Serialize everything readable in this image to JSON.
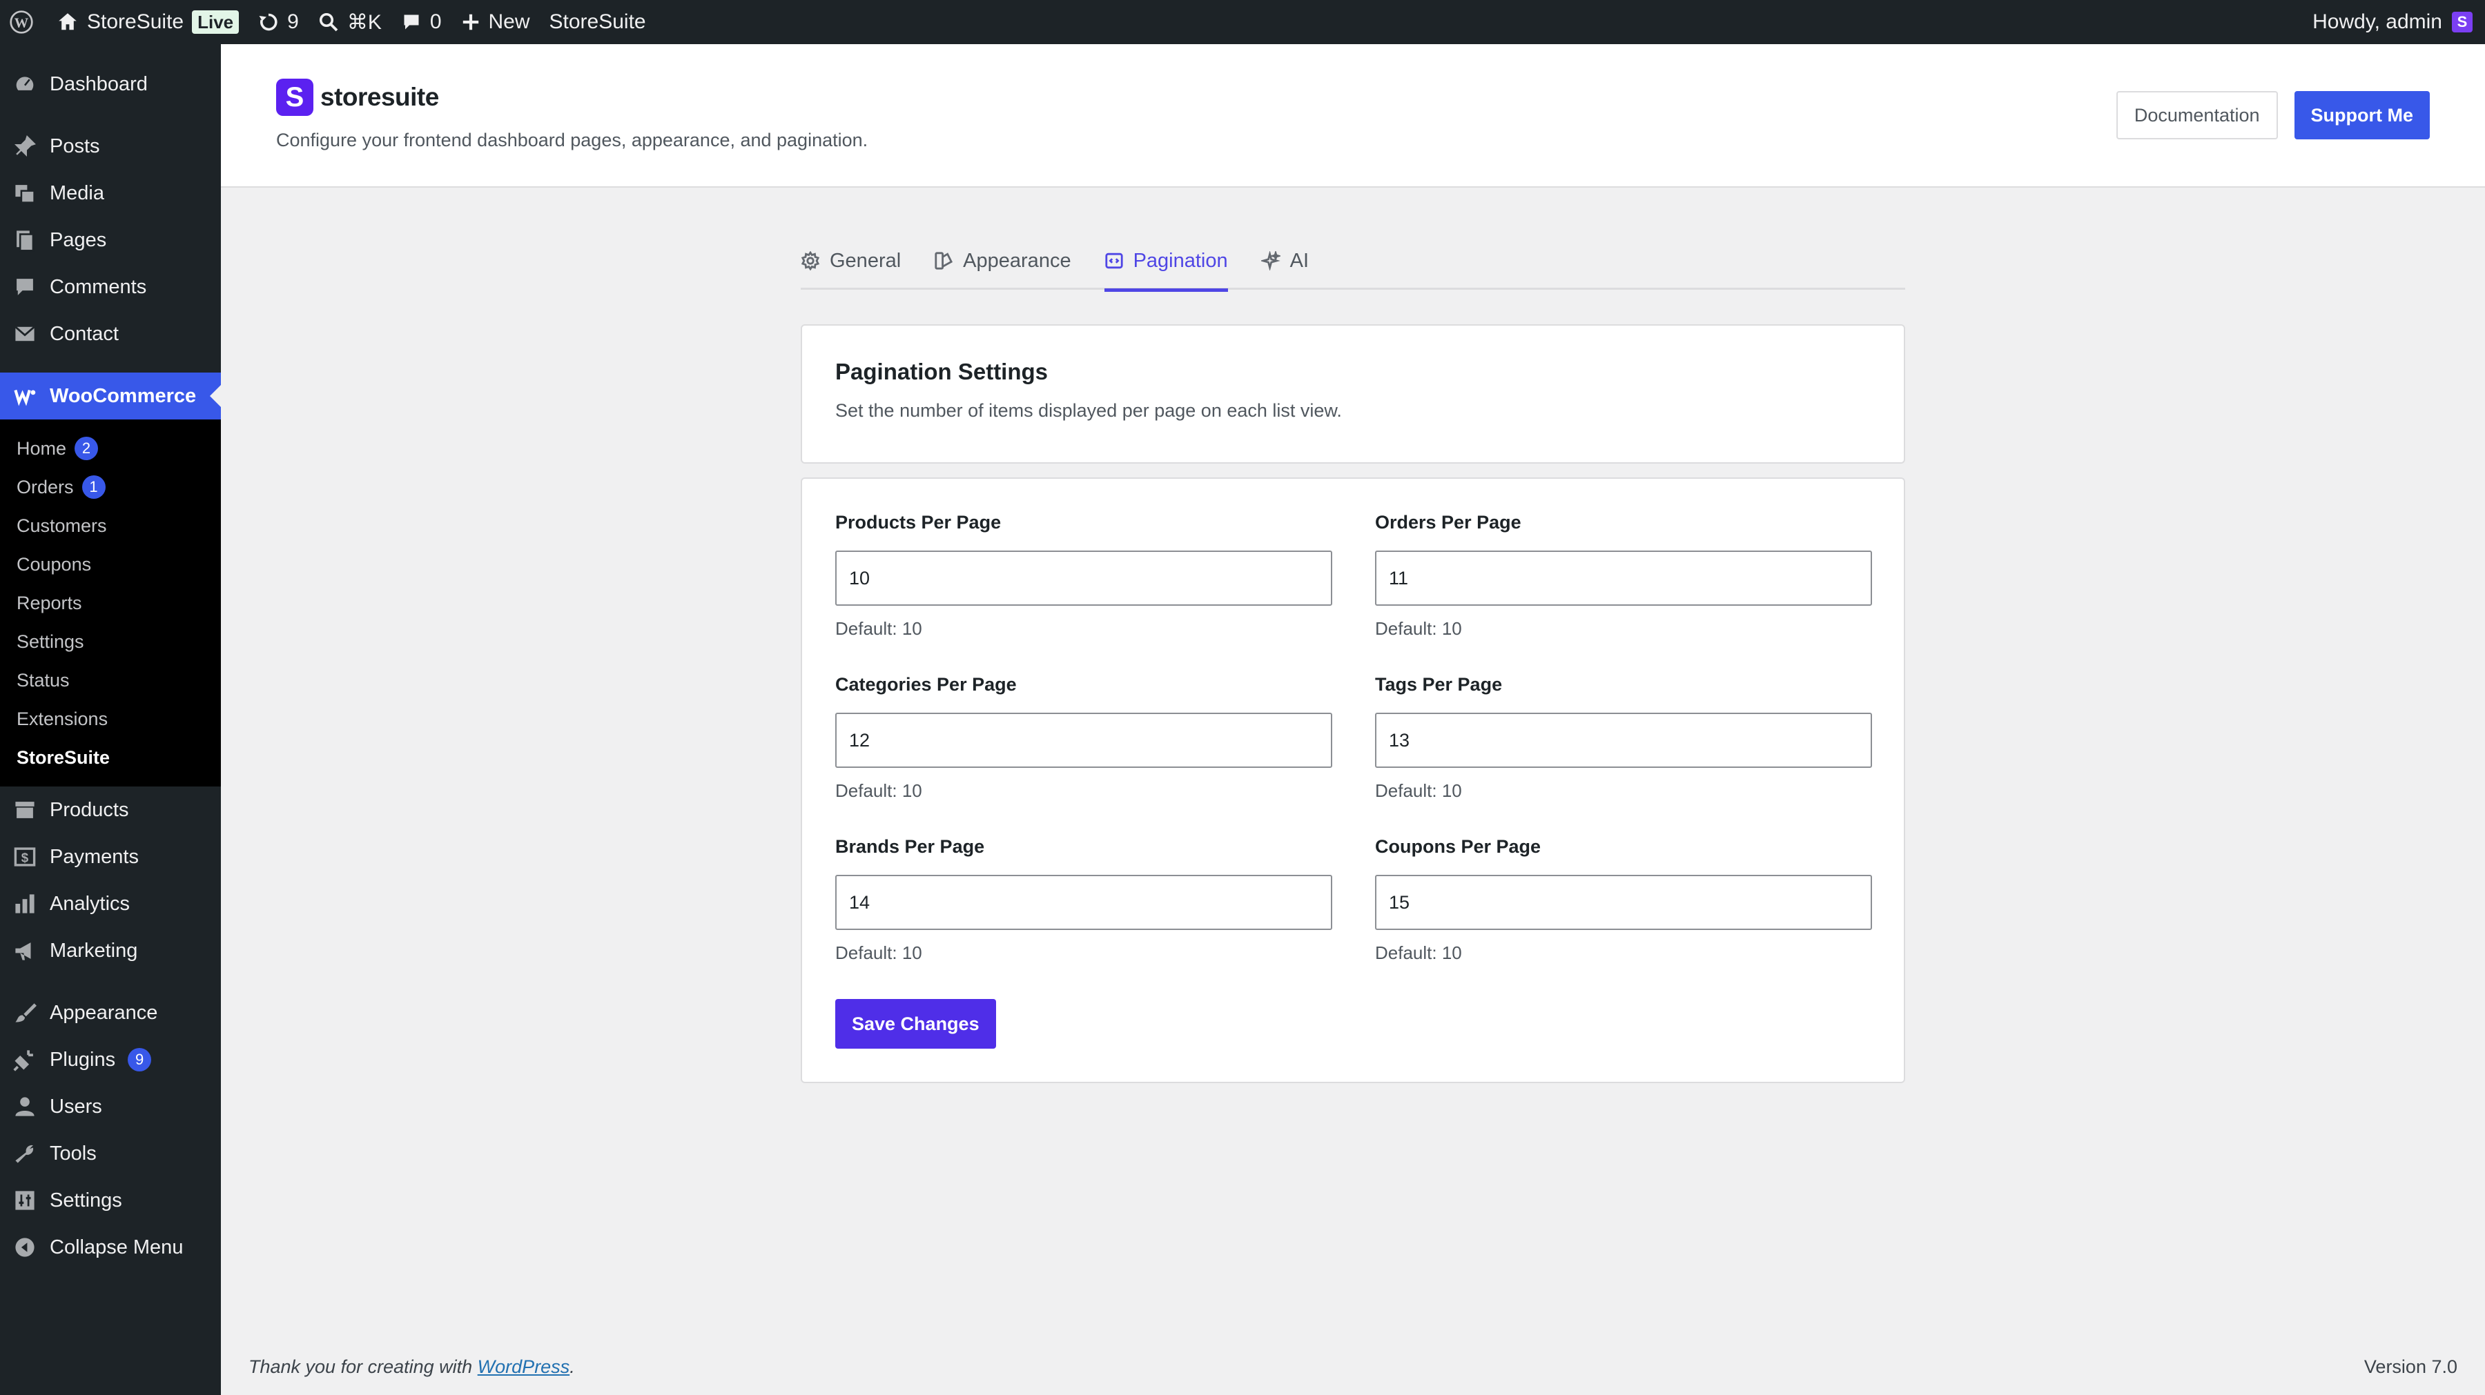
{
  "adminbar": {
    "site_name": "StoreSuite",
    "live_label": "Live",
    "updates_count": "9",
    "search_shortcut": "⌘K",
    "comments_count": "0",
    "new_label": "New",
    "plugin_label": "StoreSuite",
    "greeting": "Howdy, admin"
  },
  "sidebar": {
    "dashboard": "Dashboard",
    "posts": "Posts",
    "media": "Media",
    "pages": "Pages",
    "comments": "Comments",
    "contact": "Contact",
    "woocommerce": "WooCommerce",
    "woo_sub": [
      {
        "label": "Home",
        "badge": "2"
      },
      {
        "label": "Orders",
        "badge": "1"
      },
      {
        "label": "Customers"
      },
      {
        "label": "Coupons"
      },
      {
        "label": "Reports"
      },
      {
        "label": "Settings"
      },
      {
        "label": "Status"
      },
      {
        "label": "Extensions"
      },
      {
        "label": "StoreSuite"
      }
    ],
    "products": "Products",
    "payments": "Payments",
    "analytics": "Analytics",
    "marketing": "Marketing",
    "appearance": "Appearance",
    "plugins": "Plugins",
    "plugins_badge": "9",
    "users": "Users",
    "tools": "Tools",
    "settings": "Settings",
    "collapse": "Collapse Menu"
  },
  "header": {
    "brand_name": "storesuite",
    "description": "Configure your frontend dashboard pages, appearance, and pagination.",
    "documentation": "Documentation",
    "support": "Support Me"
  },
  "tabs": [
    {
      "label": "General",
      "icon": "gear-icon"
    },
    {
      "label": "Appearance",
      "icon": "appearance-icon"
    },
    {
      "label": "Pagination",
      "icon": "pagination-icon",
      "active": true
    },
    {
      "label": "AI",
      "icon": "sparkle-icon"
    }
  ],
  "intro": {
    "title": "Pagination Settings",
    "description": "Set the number of items displayed per page on each list view."
  },
  "fields": {
    "products": {
      "label": "Products Per Page",
      "value": "10",
      "hint": "Default: 10"
    },
    "orders": {
      "label": "Orders Per Page",
      "value": "11",
      "hint": "Default: 10"
    },
    "categories": {
      "label": "Categories Per Page",
      "value": "12",
      "hint": "Default: 10"
    },
    "tags": {
      "label": "Tags Per Page",
      "value": "13",
      "hint": "Default: 10"
    },
    "brands": {
      "label": "Brands Per Page",
      "value": "14",
      "hint": "Default: 10"
    },
    "coupons": {
      "label": "Coupons Per Page",
      "value": "15",
      "hint": "Default: 10"
    }
  },
  "save_label": "Save Changes",
  "footer": {
    "thanks_prefix": "Thank you for creating with ",
    "wp_link": "WordPress",
    "thanks_suffix": ".",
    "version": "Version 7.0"
  },
  "colors": {
    "accent": "#3858e9",
    "save_button": "#4f2ee8",
    "brand": "#5b21f0",
    "active_tab": "#4f46e5"
  }
}
